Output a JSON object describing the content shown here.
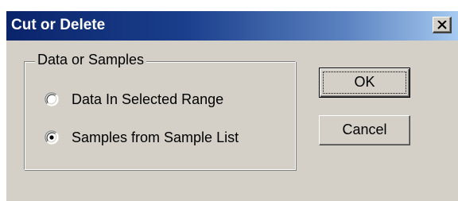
{
  "window": {
    "title": "Cut or Delete",
    "close_icon": "close-x-icon"
  },
  "group": {
    "label": "Data or Samples",
    "options": [
      {
        "label": "Data In Selected Range",
        "selected": false
      },
      {
        "label": "Samples from Sample List",
        "selected": true
      }
    ]
  },
  "buttons": {
    "ok_label": "OK",
    "cancel_label": "Cancel"
  },
  "colors": {
    "titlebar_start": "#0a246a",
    "titlebar_end": "#a6caf0",
    "face": "#d4d0c8"
  }
}
